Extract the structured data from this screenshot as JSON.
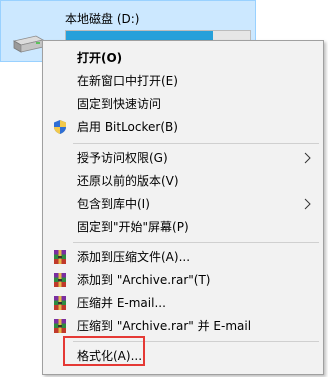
{
  "drive": {
    "label": "本地磁盘 (D:)",
    "usage_fraction": 0.8,
    "bar_color": "#26a0da",
    "icon": "hard-drive-icon"
  },
  "menu": {
    "items": [
      {
        "label": "打开(O)",
        "bold": true
      },
      {
        "label": "在新窗口中打开(E)"
      },
      {
        "label": "固定到快速访问"
      },
      {
        "label": "启用 BitLocker(B)",
        "icon": "shield-icon"
      },
      {
        "label": "授予访问权限(G)",
        "submenu": true
      },
      {
        "label": "还原以前的版本(V)"
      },
      {
        "label": "包含到库中(I)",
        "submenu": true
      },
      {
        "label": "固定到\"开始\"屏幕(P)"
      },
      {
        "label": "添加到压缩文件(A)...",
        "icon": "winrar-icon"
      },
      {
        "label": "添加到 \"Archive.rar\"(T)",
        "icon": "winrar-icon"
      },
      {
        "label": "压缩并 E-mail...",
        "icon": "winrar-icon"
      },
      {
        "label": "压缩到 \"Archive.rar\" 并 E-mail",
        "icon": "winrar-icon"
      },
      {
        "label": "格式化(A)...",
        "highlighted": true
      }
    ],
    "highlight_color": "#e53935"
  }
}
